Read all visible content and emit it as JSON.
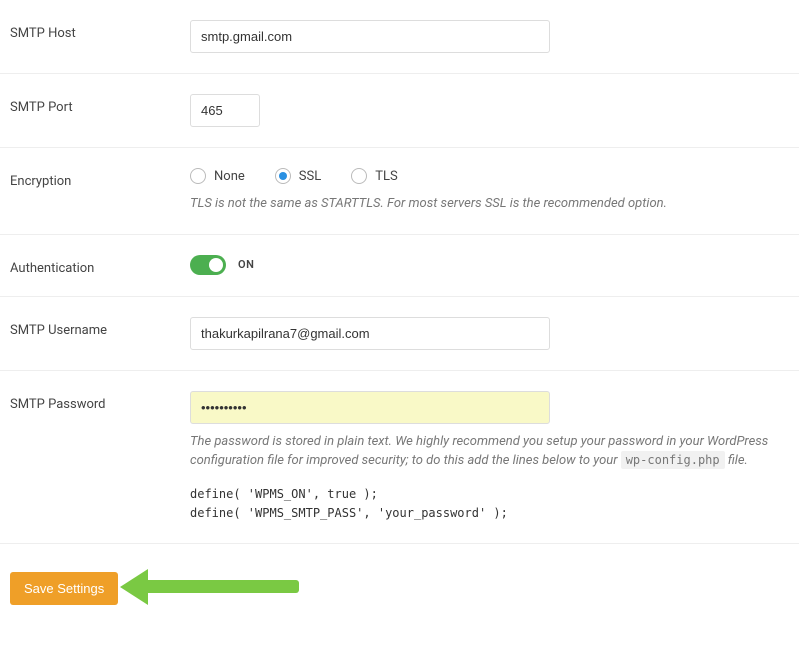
{
  "smtp_host": {
    "label": "SMTP Host",
    "value": "smtp.gmail.com"
  },
  "smtp_port": {
    "label": "SMTP Port",
    "value": "465"
  },
  "encryption": {
    "label": "Encryption",
    "options": {
      "none": "None",
      "ssl": "SSL",
      "tls": "TLS"
    },
    "selected": "ssl",
    "help": "TLS is not the same as STARTTLS. For most servers SSL is the recommended option."
  },
  "auth": {
    "label": "Authentication",
    "status": "ON"
  },
  "smtp_user": {
    "label": "SMTP Username",
    "value": "thakurkapilrana7@gmail.com"
  },
  "smtp_pass": {
    "label": "SMTP Password",
    "value": "••••••••••",
    "help_pre": "The password is stored in plain text. We highly recommend you setup your password in your WordPress configuration file for improved security; to do this add the lines below to your ",
    "help_code": "wp-config.php",
    "help_post": " file.",
    "code": "define( 'WPMS_ON', true );\ndefine( 'WPMS_SMTP_PASS', 'your_password' );"
  },
  "save_button": "Save Settings"
}
